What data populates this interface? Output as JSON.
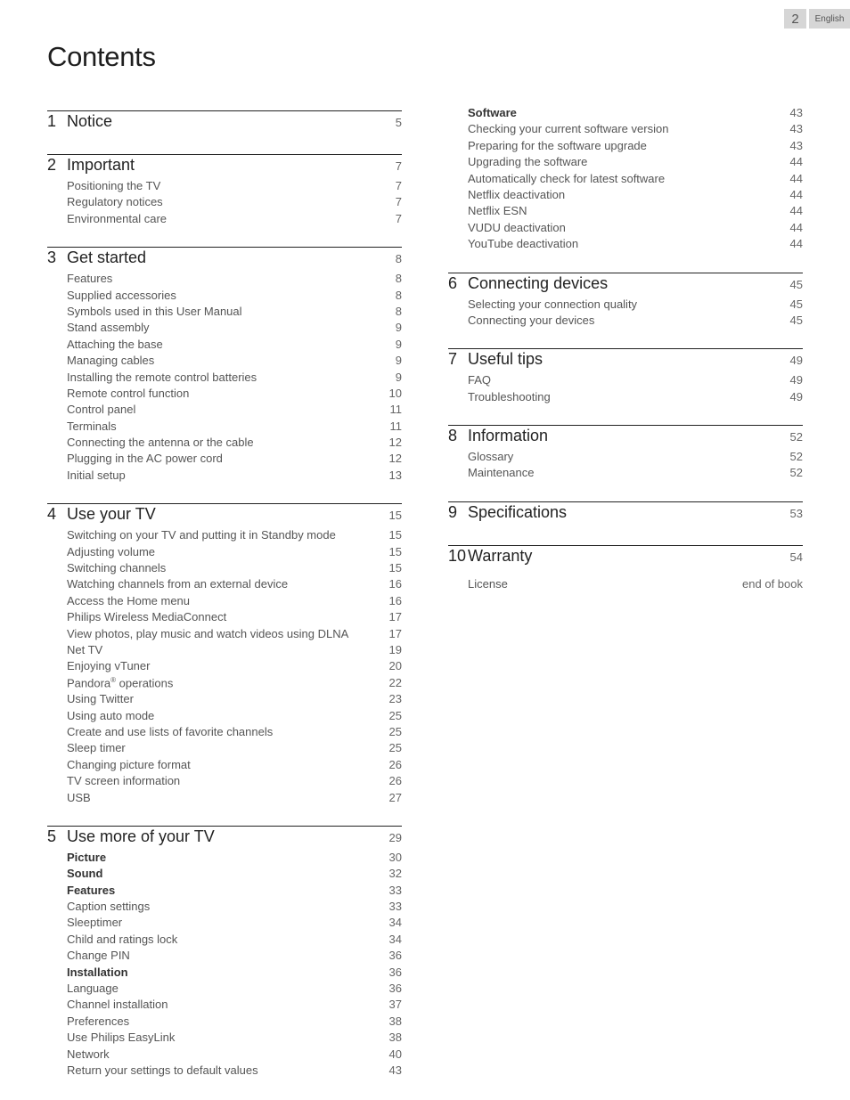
{
  "header": {
    "page_number": "2",
    "language": "English"
  },
  "title": "Contents",
  "left_column": [
    {
      "num": "1",
      "title": "Notice",
      "page": "5",
      "items": []
    },
    {
      "num": "2",
      "title": "Important",
      "page": "7",
      "items": [
        {
          "label": "Positioning the TV",
          "page": "7"
        },
        {
          "label": "Regulatory notices",
          "page": "7"
        },
        {
          "label": "Environmental care",
          "page": "7"
        }
      ]
    },
    {
      "num": "3",
      "title": "Get started",
      "page": "8",
      "items": [
        {
          "label": "Features",
          "page": "8"
        },
        {
          "label": "Supplied accessories",
          "page": "8"
        },
        {
          "label": "Symbols used in this User Manual",
          "page": "8"
        },
        {
          "label": "Stand assembly",
          "page": "9"
        },
        {
          "label": "Attaching the base",
          "page": "9"
        },
        {
          "label": "Managing cables",
          "page": "9"
        },
        {
          "label": "Installing the remote control batteries",
          "page": "9"
        },
        {
          "label": "Remote control function",
          "page": "10"
        },
        {
          "label": "Control panel",
          "page": "11"
        },
        {
          "label": "Terminals",
          "page": "11"
        },
        {
          "label": "Connecting the antenna or the cable",
          "page": "12"
        },
        {
          "label": "Plugging in the AC power cord",
          "page": "12"
        },
        {
          "label": "Initial setup",
          "page": "13"
        }
      ]
    },
    {
      "num": "4",
      "title": "Use your TV",
      "page": "15",
      "items": [
        {
          "label": "Switching on your TV and putting it in Standby mode",
          "page": "15"
        },
        {
          "label": "Adjusting volume",
          "page": "15"
        },
        {
          "label": "Switching channels",
          "page": "15"
        },
        {
          "label": "Watching channels from an external device",
          "page": "16"
        },
        {
          "label": "Access the Home menu",
          "page": "16"
        },
        {
          "label": "Philips Wireless MediaConnect",
          "page": "17"
        },
        {
          "label": "View photos, play music and watch videos using DLNA",
          "page": "17"
        },
        {
          "label": "Net TV",
          "page": "19"
        },
        {
          "label": "Enjoying vTuner",
          "page": "20"
        },
        {
          "label": "Pandora",
          "sup": "®",
          "label_suffix": " operations",
          "page": "22"
        },
        {
          "label": "Using Twitter",
          "page": "23"
        },
        {
          "label": "Using auto mode",
          "page": "25"
        },
        {
          "label": "Create and use lists of favorite channels",
          "page": "25"
        },
        {
          "label": "Sleep timer",
          "page": "25"
        },
        {
          "label": "Changing picture format",
          "page": "26"
        },
        {
          "label": "TV screen information",
          "page": "26"
        },
        {
          "label": "USB",
          "page": "27"
        }
      ]
    },
    {
      "num": "5",
      "title": "Use more of your TV",
      "page": "29",
      "items": [
        {
          "label": "Picture",
          "page": "30",
          "bold": true
        },
        {
          "label": "Sound",
          "page": "32",
          "bold": true
        },
        {
          "label": "Features",
          "page": "33",
          "bold": true
        },
        {
          "label": "Caption settings",
          "page": "33"
        },
        {
          "label": "Sleeptimer",
          "page": "34"
        },
        {
          "label": "Child and ratings lock",
          "page": "34"
        },
        {
          "label": "Change PIN",
          "page": "36"
        },
        {
          "label": "Installation",
          "page": "36",
          "bold": true
        },
        {
          "label": "Language",
          "page": "36"
        },
        {
          "label": "Channel installation",
          "page": "37"
        },
        {
          "label": "Preferences",
          "page": "38"
        },
        {
          "label": "Use Philips EasyLink",
          "page": "38"
        },
        {
          "label": "Network",
          "page": "40"
        },
        {
          "label": "Return your settings to default values",
          "page": "43"
        }
      ]
    }
  ],
  "right_column": [
    {
      "continued": true,
      "items": [
        {
          "label": "Software",
          "page": "43",
          "bold": true
        },
        {
          "label": "Checking your current software version",
          "page": "43"
        },
        {
          "label": "Preparing for the software upgrade",
          "page": "43"
        },
        {
          "label": "Upgrading the software",
          "page": "44"
        },
        {
          "label": "Automatically check for latest software",
          "page": "44"
        },
        {
          "label": "Netflix deactivation",
          "page": "44"
        },
        {
          "label": "Netflix ESN",
          "page": "44"
        },
        {
          "label": "VUDU deactivation",
          "page": "44"
        },
        {
          "label": "YouTube deactivation",
          "page": "44"
        }
      ]
    },
    {
      "num": "6",
      "title": "Connecting devices",
      "page": "45",
      "items": [
        {
          "label": "Selecting your connection quality",
          "page": "45"
        },
        {
          "label": "Connecting your devices",
          "page": "45"
        }
      ]
    },
    {
      "num": "7",
      "title": "Useful tips",
      "page": "49",
      "items": [
        {
          "label": "FAQ",
          "page": "49"
        },
        {
          "label": "Troubleshooting",
          "page": "49"
        }
      ]
    },
    {
      "num": "8",
      "title": "Information",
      "page": "52",
      "items": [
        {
          "label": "Glossary",
          "page": "52"
        },
        {
          "label": "Maintenance",
          "page": "52"
        }
      ]
    },
    {
      "num": "9",
      "title": "Specifications",
      "page": "53",
      "items": []
    },
    {
      "num": "10",
      "title": "Warranty",
      "page": "54",
      "items": [
        {
          "label": "License",
          "page": "end of book",
          "gap": true
        }
      ]
    }
  ]
}
